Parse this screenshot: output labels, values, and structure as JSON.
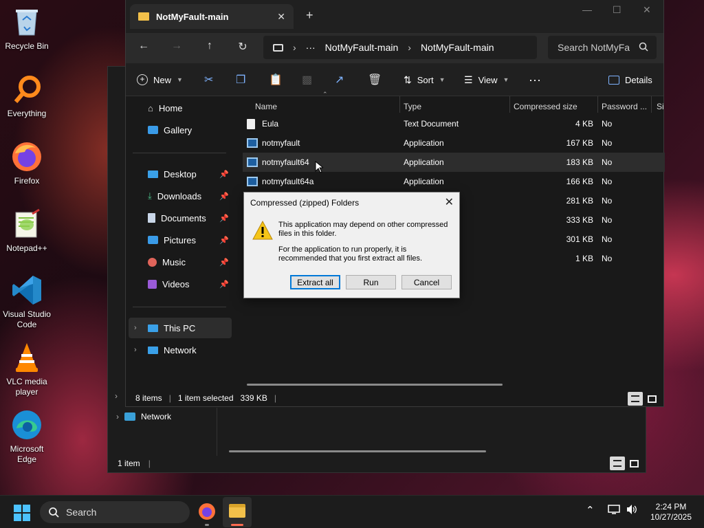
{
  "desktop_icons": [
    {
      "label": "Recycle Bin",
      "icon": "recycle-bin-icon"
    },
    {
      "label": "Everything",
      "icon": "everything-search-icon"
    },
    {
      "label": "Firefox",
      "icon": "firefox-icon"
    },
    {
      "label": "Notepad++",
      "icon": "notepadpp-icon"
    },
    {
      "label": "Visual Studio Code",
      "icon": "vscode-icon"
    },
    {
      "label": "VLC media player",
      "icon": "vlc-icon"
    },
    {
      "label": "Microsoft Edge",
      "icon": "edge-icon"
    }
  ],
  "back_window": {
    "nav_network": "Network",
    "status": "1 item"
  },
  "explorer": {
    "tab_title": "NotMyFault-main",
    "breadcrumbs": [
      "NotMyFault-main",
      "NotMyFault-main"
    ],
    "search_placeholder": "Search NotMyFa",
    "toolbar": {
      "new_label": "New",
      "sort_label": "Sort",
      "view_label": "View",
      "details_label": "Details"
    },
    "sidebar": {
      "home": "Home",
      "gallery": "Gallery",
      "desktop": "Desktop",
      "downloads": "Downloads",
      "documents": "Documents",
      "pictures": "Pictures",
      "music": "Music",
      "videos": "Videos",
      "this_pc": "This PC",
      "network": "Network"
    },
    "columns": {
      "name": "Name",
      "type": "Type",
      "compressed_size": "Compressed size",
      "password": "Password ...",
      "size_trunc": "Si"
    },
    "files": [
      {
        "name": "Eula",
        "type": "Text Document",
        "size": "4 KB",
        "password": "No"
      },
      {
        "name": "notmyfault",
        "type": "Application",
        "size": "167 KB",
        "password": "No"
      },
      {
        "name": "notmyfault64",
        "type": "Application",
        "size": "183 KB",
        "password": "No"
      },
      {
        "name": "notmyfault64a",
        "type": "Application",
        "size": "166 KB",
        "password": "No"
      },
      {
        "name": "",
        "type": "",
        "size": "281 KB",
        "password": "No"
      },
      {
        "name": "",
        "type": "",
        "size": "333 KB",
        "password": "No"
      },
      {
        "name": "",
        "type": "",
        "size": "301 KB",
        "password": "No"
      },
      {
        "name": "",
        "type": "",
        "size": "1 KB",
        "password": "No"
      }
    ],
    "status": {
      "count": "8 items",
      "selected": "1 item selected",
      "selected_size": "339 KB"
    }
  },
  "dialog": {
    "title": "Compressed (zipped) Folders",
    "message1": "This application may depend on other compressed files in this folder.",
    "message2": "For the application to run properly, it is recommended that you first extract all files.",
    "btn_extract": "Extract all",
    "btn_run": "Run",
    "btn_cancel": "Cancel"
  },
  "taskbar": {
    "search_label": "Search",
    "time": "2:24 PM",
    "date": "10/27/2025"
  },
  "colors": {
    "accent": "#0078d7",
    "folder": "#f2c04a"
  }
}
